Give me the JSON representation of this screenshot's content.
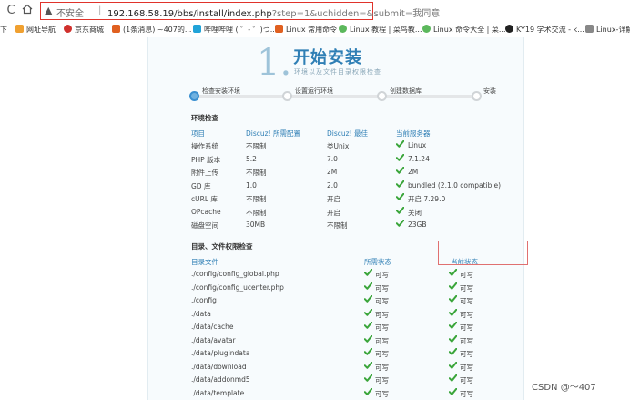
{
  "browser": {
    "reload_icon": "reload-icon",
    "warning_icon": "warning-triangle-icon",
    "insecure_label": "不安全",
    "url_host_path": "192.168.58.19/bbs/install/index.php",
    "url_query": "?step=1&uchidden=&submit=我同意",
    "bookmarks": [
      {
        "label": "下"
      },
      {
        "label": "网址导航",
        "color": "#f0a030"
      },
      {
        "label": "京东商城",
        "color": "#d0312d"
      },
      {
        "label": "(1条消息) ~407的...",
        "color": "#e06020"
      },
      {
        "label": "哔哩哔哩 ( ゜- ゜)つ...",
        "color": "#21a3d8"
      },
      {
        "label": "Linux 常用命令",
        "color": "#e06020"
      },
      {
        "label": "Linux 教程 | 菜鸟教...",
        "color": "#5cb85c"
      },
      {
        "label": "Linux 命令大全 | 菜...",
        "color": "#5cb85c"
      },
      {
        "label": "KY19 学术交流 - k...",
        "color": "#222222"
      },
      {
        "label": "Linux-详解",
        "color": "#888888"
      }
    ]
  },
  "install": {
    "step_number": "1.",
    "step_title": "开始安装",
    "step_subtitle": "环境以及文件目录权限检查",
    "progress_value": 0,
    "steps": [
      "检查安装环境",
      "设置运行环境",
      "创建数据库",
      "安装"
    ],
    "env": {
      "title": "环境检查",
      "headers": [
        "项目",
        "Discuz! 所需配置",
        "Discuz! 最佳",
        "当前服务器"
      ],
      "rows": [
        {
          "item": "操作系统",
          "req": "不限制",
          "best": "类Unix",
          "current": "Linux"
        },
        {
          "item": "PHP 版本",
          "req": "5.2",
          "best": "7.0",
          "current": "7.1.24"
        },
        {
          "item": "附件上传",
          "req": "不限制",
          "best": "2M",
          "current": "2M"
        },
        {
          "item": "GD 库",
          "req": "1.0",
          "best": "2.0",
          "current": "bundled (2.1.0 compatible)"
        },
        {
          "item": "cURL 库",
          "req": "不限制",
          "best": "开启",
          "current": "开启 7.29.0"
        },
        {
          "item": "OPcache",
          "req": "不限制",
          "best": "开启",
          "current": "关闭"
        },
        {
          "item": "磁盘空间",
          "req": "30MB",
          "best": "不限制",
          "current": "23GB"
        }
      ]
    },
    "dirs": {
      "title": "目录、文件权限检查",
      "headers": [
        "目录文件",
        "所需状态",
        "当前状态"
      ],
      "rows": [
        {
          "path": "./config/config_global.php",
          "req": "可写",
          "cur": "可写"
        },
        {
          "path": "./config/config_ucenter.php",
          "req": "可写",
          "cur": "可写"
        },
        {
          "path": "./config",
          "req": "可写",
          "cur": "可写"
        },
        {
          "path": "./data",
          "req": "可写",
          "cur": "可写"
        },
        {
          "path": "./data/cache",
          "req": "可写",
          "cur": "可写"
        },
        {
          "path": "./data/avatar",
          "req": "可写",
          "cur": "可写"
        },
        {
          "path": "./data/plugindata",
          "req": "可写",
          "cur": "可写"
        },
        {
          "path": "./data/download",
          "req": "可写",
          "cur": "可写"
        },
        {
          "path": "./data/addonmd5",
          "req": "可写",
          "cur": "可写"
        },
        {
          "path": "./data/template",
          "req": "可写",
          "cur": "可写"
        }
      ]
    }
  },
  "watermark": "CSDN @～407",
  "colors": {
    "accent": "#2f7fb5",
    "check": "#3aa53a",
    "highlight": "#e07070"
  }
}
